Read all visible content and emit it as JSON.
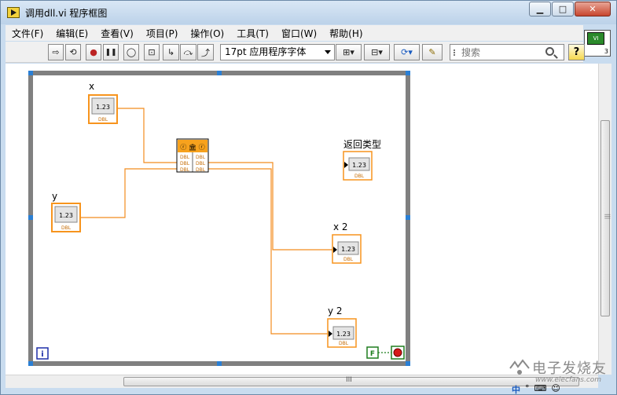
{
  "window": {
    "title": "调用dll.vi 程序框图",
    "min_glyph": "▁",
    "max_glyph": "□",
    "close_glyph": "✕"
  },
  "menu": {
    "items": [
      {
        "label": "文件(F)"
      },
      {
        "label": "编辑(E)"
      },
      {
        "label": "查看(V)"
      },
      {
        "label": "项目(P)"
      },
      {
        "label": "操作(O)"
      },
      {
        "label": "工具(T)"
      },
      {
        "label": "窗口(W)"
      },
      {
        "label": "帮助(H)"
      }
    ]
  },
  "toolbar": {
    "font_select_value": "17pt 应用程序字体",
    "search_placeholder": "搜索",
    "help_label": "?",
    "buttons": [
      {
        "icon": "run-arrow-icon",
        "glyph": "⇨"
      },
      {
        "icon": "run-continuously-icon",
        "glyph": "⟲"
      },
      {
        "icon": "abort-stop-icon",
        "glyph": "●"
      },
      {
        "icon": "pause-icon",
        "glyph": "❚❚"
      },
      {
        "icon": "highlight-execution-bulb-icon",
        "glyph": "◯"
      },
      {
        "icon": "retain-wire-values-icon",
        "glyph": "⊡"
      },
      {
        "icon": "step-into-icon",
        "glyph": "↳"
      },
      {
        "icon": "step-over-icon",
        "glyph": "⤼"
      },
      {
        "icon": "step-out-icon",
        "glyph": "⤴"
      },
      {
        "icon": "align-objects-icon",
        "glyph": "⊞▾"
      },
      {
        "icon": "distribute-objects-icon",
        "glyph": "⊟▾"
      },
      {
        "icon": "reorder-icon",
        "glyph": "⟳▾"
      },
      {
        "icon": "clean-up-diagram-icon",
        "glyph": "✎"
      }
    ]
  },
  "vi_icon": {
    "text": "VI",
    "number": "3"
  },
  "diagram": {
    "labels": {
      "x": "x",
      "y": "y",
      "return_type": "返回类型",
      "x2": "x 2",
      "y2": "y 2"
    },
    "numeric_text": "1.23",
    "type_text": "DBL",
    "iteration_terminal": "i",
    "false_constant": "F",
    "call_node_top": "ⓡ 🏛 ⓡ",
    "call_node_rows": [
      "DBL",
      "DBL",
      "DBL"
    ]
  },
  "watermark": {
    "text": "电子发烧友",
    "url": "www.elecfans.com"
  },
  "tray": {
    "items": [
      "中",
      "°",
      "⌨",
      "☺"
    ]
  },
  "colors": {
    "wire_orange": "#f28c1e",
    "terminal_orange": "#f7941d",
    "loop_gray": "#808080",
    "handle_blue": "#2a7fd4",
    "iteration_blue": "#1e2fa8",
    "stop_green": "#1e7d1e"
  }
}
